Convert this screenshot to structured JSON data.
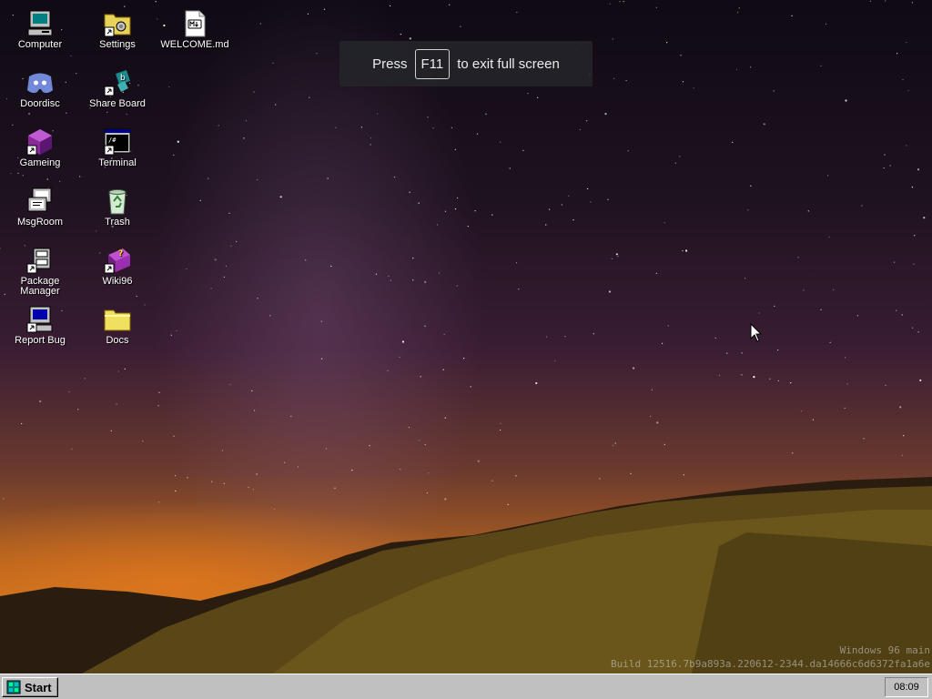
{
  "desktop": {
    "icons": [
      {
        "label": "Computer",
        "icon": "computer-icon"
      },
      {
        "label": "Settings",
        "icon": "settings-folder-icon"
      },
      {
        "label": "WELCOME.md",
        "icon": "markdown-file-icon"
      },
      {
        "label": "Doordisc",
        "icon": "discord-icon"
      },
      {
        "label": "Share Board",
        "icon": "share-board-icon"
      },
      {
        "label": "Gameing",
        "icon": "game-cube-icon"
      },
      {
        "label": "Terminal",
        "icon": "terminal-icon"
      },
      {
        "label": "MsgRoom",
        "icon": "msgroom-icon"
      },
      {
        "label": "Trash",
        "icon": "recycle-bin-icon"
      },
      {
        "label": "Package Manager",
        "icon": "package-manager-icon"
      },
      {
        "label": "Wiki96",
        "icon": "wiki-book-icon"
      },
      {
        "label": "Report Bug",
        "icon": "report-bug-icon"
      },
      {
        "label": "Docs",
        "icon": "folder-icon"
      }
    ]
  },
  "fullscreen_banner": {
    "prefix": "Press",
    "key": "F11",
    "suffix": "to exit full screen"
  },
  "watermark": {
    "line1": "Windows 96 main",
    "line2": "Build 12516.7b9a893a.220612-2344.da14666c6d6372fa1a6e"
  },
  "taskbar": {
    "start_label": "Start",
    "clock": "08:09"
  },
  "colors": {
    "taskbar": "#c0c0c0",
    "banner": "#24242a",
    "horizon_glow": "#c9741e"
  }
}
